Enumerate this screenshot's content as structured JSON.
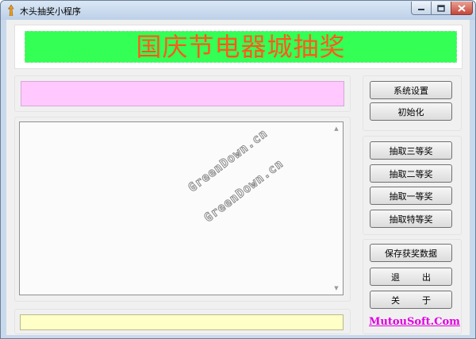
{
  "window": {
    "title": "木头抽奖小程序"
  },
  "banner": {
    "text": "国庆节电器城抽奖",
    "bg_color": "#33ff55",
    "text_color": "#ff5a1a"
  },
  "panels": {
    "pink_box_value": "",
    "listbox_items": [],
    "yellow_box_value": ""
  },
  "buttons": {
    "system_settings": "系统设置",
    "initialize": "初始化",
    "draw_third_prize": "抽取三等奖",
    "draw_second_prize": "抽取二等奖",
    "draw_first_prize": "抽取一等奖",
    "draw_special_prize": "抽取特等奖",
    "save_winner_data": "保存获奖数据",
    "exit": "退        出",
    "about": "关        于"
  },
  "link": {
    "text": "MutouSoft.Com",
    "color": "#e000e0"
  },
  "watermarks": [
    "GreenDown.cn",
    "GreenDown.cn"
  ]
}
